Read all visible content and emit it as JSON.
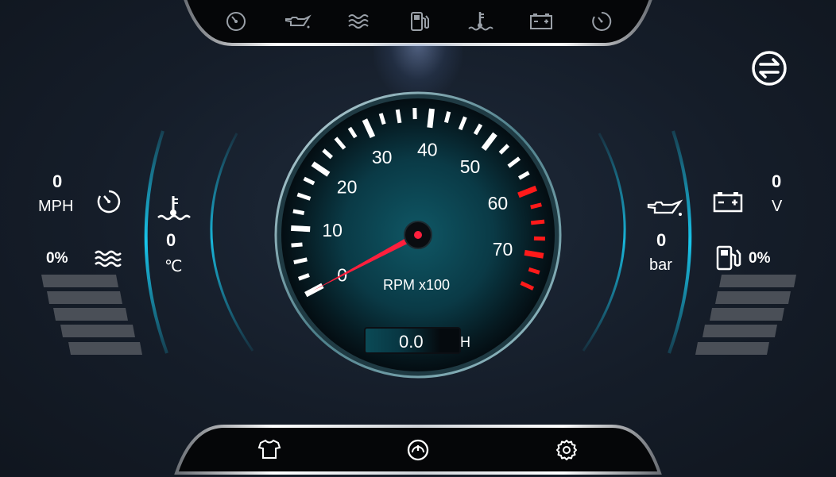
{
  "top_bar": {
    "icons": [
      "speedometer-icon",
      "oil-can-icon",
      "coolant-waves-icon",
      "fuel-pump-icon",
      "coolant-temp-icon",
      "battery-icon",
      "timer-icon"
    ]
  },
  "swap_button_icon": "swap-arrows-icon",
  "left_panel": {
    "speed_value": "0",
    "speed_unit": "MPH",
    "coolant_temp_value": "0",
    "coolant_temp_unit": "℃",
    "intake_percent": "0%",
    "level_fraction": 0
  },
  "right_panel": {
    "voltage_value": "0",
    "voltage_unit": "V",
    "oil_pressure_value": "0",
    "oil_pressure_unit": "bar",
    "fuel_percent": "0%",
    "level_fraction": 0
  },
  "gauge": {
    "unit_label": "RPM x100",
    "rpm_value": 0,
    "tick_labels": [
      "0",
      "10",
      "20",
      "30",
      "40",
      "50",
      "60",
      "70"
    ],
    "hours_value": "0.0",
    "hours_unit": "H",
    "redline_start": 60
  },
  "bottom_bar": {
    "icons": [
      "shirt-icon",
      "gauge-icon",
      "gear-icon"
    ]
  },
  "colors": {
    "accent": "#18c6ec",
    "redline": "#ff1a1a",
    "needle": "#ff1f3d"
  }
}
